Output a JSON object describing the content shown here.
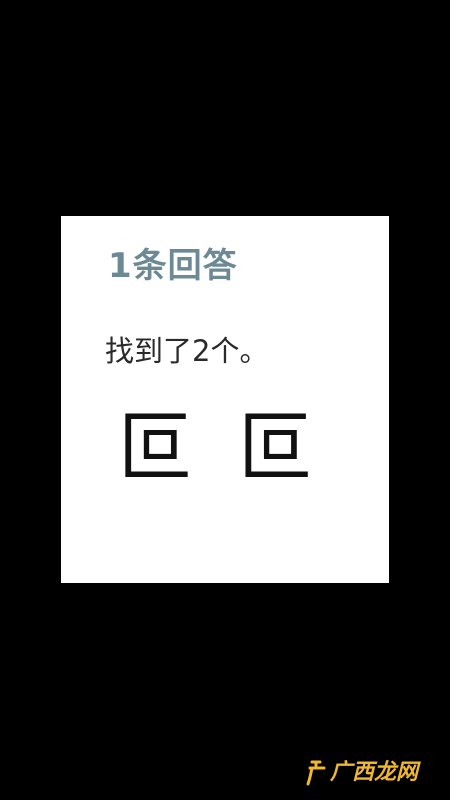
{
  "answer": {
    "count_label": "1条回答",
    "text": "找到了2个。",
    "characters": "叵 叵"
  },
  "watermark": {
    "text": "广西龙网",
    "color": "#f0b830"
  },
  "colors": {
    "background": "#000000",
    "card": "#ffffff",
    "count_label": "#6c8a96"
  }
}
